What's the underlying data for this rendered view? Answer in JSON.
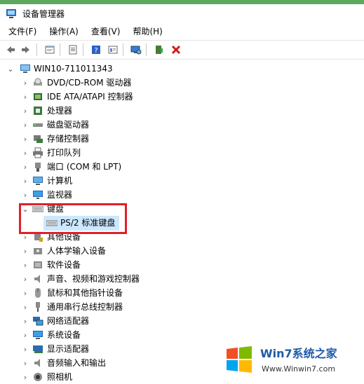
{
  "window": {
    "title": "设备管理器"
  },
  "menu": [
    "文件(F)",
    "操作(A)",
    "查看(V)",
    "帮助(H)"
  ],
  "toolbar": [
    {
      "name": "back-icon"
    },
    {
      "name": "forward-icon"
    },
    {
      "sep": true
    },
    {
      "name": "properties-icon"
    },
    {
      "sep": true
    },
    {
      "name": "show-hidden-icon"
    },
    {
      "sep": true
    },
    {
      "name": "help-icon"
    },
    {
      "name": "view-icon"
    },
    {
      "sep": true
    },
    {
      "name": "scan-hardware-icon"
    },
    {
      "sep": true
    },
    {
      "name": "update-driver-icon"
    },
    {
      "name": "uninstall-icon"
    }
  ],
  "tree": {
    "root": "WIN10-711011343",
    "items": [
      {
        "label": "DVD/CD-ROM 驱动器",
        "icon": "dvd-icon"
      },
      {
        "label": "IDE ATA/ATAPI 控制器",
        "icon": "ide-icon"
      },
      {
        "label": "处理器",
        "icon": "cpu-icon"
      },
      {
        "label": "磁盘驱动器",
        "icon": "disk-icon"
      },
      {
        "label": "存储控制器",
        "icon": "storage-icon"
      },
      {
        "label": "打印队列",
        "icon": "printer-icon"
      },
      {
        "label": "端口 (COM 和 LPT)",
        "icon": "port-icon"
      },
      {
        "label": "计算机",
        "icon": "computer-icon"
      },
      {
        "label": "监视器",
        "icon": "monitor-icon"
      },
      {
        "label": "键盘",
        "icon": "keyboard-icon",
        "expanded": true
      },
      {
        "label": "PS/2 标准键盘",
        "icon": "keyboard-icon",
        "child": true,
        "selected": true
      },
      {
        "label": "其他设备",
        "icon": "other-device-icon"
      },
      {
        "label": "人体学输入设备",
        "icon": "hid-icon"
      },
      {
        "label": "软件设备",
        "icon": "software-device-icon"
      },
      {
        "label": "声音、视频和游戏控制器",
        "icon": "sound-icon"
      },
      {
        "label": "鼠标和其他指针设备",
        "icon": "mouse-icon"
      },
      {
        "label": "通用串行总线控制器",
        "icon": "usb-icon"
      },
      {
        "label": "网络适配器",
        "icon": "network-icon"
      },
      {
        "label": "系统设备",
        "icon": "system-device-icon"
      },
      {
        "label": "显示适配器",
        "icon": "display-adapter-icon"
      },
      {
        "label": "音频输入和输出",
        "icon": "audio-icon"
      },
      {
        "label": "照相机",
        "icon": "camera-icon"
      }
    ]
  },
  "watermark": {
    "brand": "Win7系统之家",
    "url": "Www.Winwin7.com"
  },
  "colors": {
    "highlight": "#e0202a",
    "selection": "#cce8ff",
    "accent": "#5fa85f"
  }
}
